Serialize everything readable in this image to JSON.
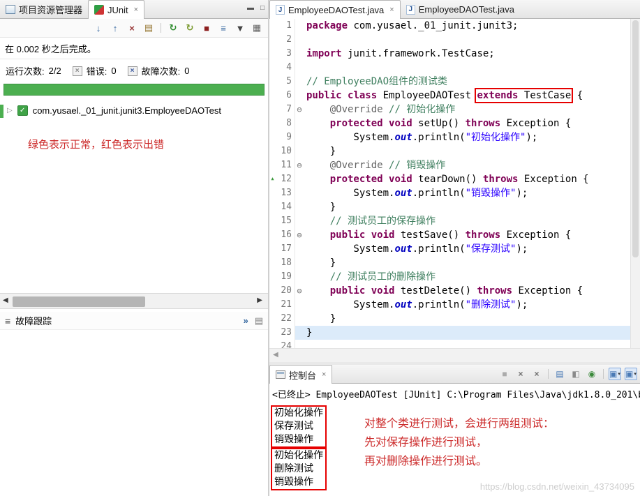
{
  "colors": {
    "kw": "#7f0055",
    "cm": "#3f7f5f",
    "st": "#2a00ff",
    "fd": "#0000c0",
    "an": "#646464",
    "ln": "#787878",
    "green": "#4caf50",
    "red": "#cc2a2a",
    "box_red": "#e60000",
    "cur": "#dcebfa"
  },
  "left_panel": {
    "tabs": [
      {
        "label": "项目资源管理器"
      },
      {
        "label": "JUnit",
        "close": "×"
      }
    ],
    "window_buttons": {
      "minimize": "▬",
      "maximize": "□"
    },
    "toolbar": [
      {
        "name": "next-failure-icon",
        "glyph": "↓",
        "color": "#35679f"
      },
      {
        "name": "previous-failure-icon",
        "glyph": "↑",
        "color": "#35679f"
      },
      {
        "name": "remove-test-run-icon",
        "glyph": "×",
        "color": "#9a3b3b"
      },
      {
        "name": "test-run-history-icon",
        "glyph": "▤",
        "color": "#9a7b3a"
      },
      {
        "name": "separator"
      },
      {
        "name": "rerun-test-icon",
        "glyph": "↻",
        "color": "#2e8b2e"
      },
      {
        "name": "rerun-failed-first-icon",
        "glyph": "↻",
        "color": "#7a9a2e"
      },
      {
        "name": "stop-test-icon",
        "glyph": "■",
        "color": "#8d2020"
      },
      {
        "name": "show-test-hierarchy-icon",
        "glyph": "≡",
        "color": "#35679f"
      },
      {
        "name": "dropdown-arrow-icon",
        "glyph": "▼",
        "color": "#444444"
      },
      {
        "name": "view-menu-icon",
        "glyph": "▦",
        "color": "#666666"
      }
    ],
    "status_text": "在 0.002 秒之后完成。",
    "stats": [
      {
        "label": "运行次数:",
        "value": "2/2"
      },
      {
        "label": "错误:",
        "value": "0"
      },
      {
        "label": "故障次数:",
        "value": "0"
      }
    ],
    "tree_item": {
      "expander": "▷",
      "label": "com.yusael._01_junit.junit3.EmployeeDAOTest"
    },
    "annotation": "绿色表示正常，红色表示出错",
    "failure_trace": {
      "label": "故障跟踪"
    }
  },
  "editor": {
    "tabs": [
      {
        "label": "EmployeeDAOTest.java",
        "close": "×"
      },
      {
        "label": "EmployeeDAOTest.java"
      }
    ],
    "current_line": 23,
    "fold_glyph": "⊖",
    "marker_glyph": "▲",
    "code_lines": [
      {
        "n": 1,
        "t": [
          [
            "kw",
            "package"
          ],
          [
            "pl",
            " com.yusael._01_junit.junit3;"
          ]
        ]
      },
      {
        "n": 2,
        "t": []
      },
      {
        "n": 3,
        "t": [
          [
            "kw",
            "import"
          ],
          [
            "pl",
            " junit.framework.TestCase;"
          ]
        ]
      },
      {
        "n": 4,
        "t": []
      },
      {
        "n": 5,
        "t": [
          [
            "cm",
            "// EmployeeDAO组件的测试类"
          ]
        ]
      },
      {
        "n": 6,
        "t": [
          [
            "kw",
            "public"
          ],
          [
            "pl",
            " "
          ],
          [
            "kw",
            "class"
          ],
          [
            "pl",
            " EmployeeDAOTest "
          ],
          [
            "kw",
            "extends",
            1
          ],
          [
            "pl",
            " TestCase",
            1
          ],
          [
            "pl",
            " {"
          ]
        ]
      },
      {
        "n": 7,
        "fold": true,
        "t": [
          [
            "pl",
            "    "
          ],
          [
            "an",
            "@Override"
          ],
          [
            "pl",
            " "
          ],
          [
            "cm",
            "// 初始化操作"
          ]
        ]
      },
      {
        "n": 8,
        "t": [
          [
            "pl",
            "    "
          ],
          [
            "kw",
            "protected"
          ],
          [
            "pl",
            " "
          ],
          [
            "kw",
            "void"
          ],
          [
            "pl",
            " setUp() "
          ],
          [
            "kw",
            "throws"
          ],
          [
            "pl",
            " Exception {"
          ]
        ]
      },
      {
        "n": 9,
        "t": [
          [
            "pl",
            "        System."
          ],
          [
            "fd",
            "out"
          ],
          [
            "pl",
            ".println("
          ],
          [
            "st",
            "\"初始化操作\""
          ],
          [
            "pl",
            ");"
          ]
        ]
      },
      {
        "n": 10,
        "t": [
          [
            "pl",
            "    }"
          ]
        ]
      },
      {
        "n": 11,
        "fold": true,
        "t": [
          [
            "pl",
            "    "
          ],
          [
            "an",
            "@Override"
          ],
          [
            "pl",
            " "
          ],
          [
            "cm",
            "// 销毁操作"
          ]
        ]
      },
      {
        "n": 12,
        "marker": true,
        "t": [
          [
            "pl",
            "    "
          ],
          [
            "kw",
            "protected"
          ],
          [
            "pl",
            " "
          ],
          [
            "kw",
            "void"
          ],
          [
            "pl",
            " tearDown() "
          ],
          [
            "kw",
            "throws"
          ],
          [
            "pl",
            " Exception {"
          ]
        ]
      },
      {
        "n": 13,
        "t": [
          [
            "pl",
            "        System."
          ],
          [
            "fd",
            "out"
          ],
          [
            "pl",
            ".println("
          ],
          [
            "st",
            "\"销毁操作\""
          ],
          [
            "pl",
            ");"
          ]
        ]
      },
      {
        "n": 14,
        "t": [
          [
            "pl",
            "    }"
          ]
        ]
      },
      {
        "n": 15,
        "t": [
          [
            "pl",
            "    "
          ],
          [
            "cm",
            "// 测试员工的保存操作"
          ]
        ]
      },
      {
        "n": 16,
        "fold": true,
        "t": [
          [
            "pl",
            "    "
          ],
          [
            "kw",
            "public"
          ],
          [
            "pl",
            " "
          ],
          [
            "kw",
            "void"
          ],
          [
            "pl",
            " testSave() "
          ],
          [
            "kw",
            "throws"
          ],
          [
            "pl",
            " Exception {"
          ]
        ]
      },
      {
        "n": 17,
        "t": [
          [
            "pl",
            "        System."
          ],
          [
            "fd",
            "out"
          ],
          [
            "pl",
            ".println("
          ],
          [
            "st",
            "\"保存测试\""
          ],
          [
            "pl",
            ");"
          ]
        ]
      },
      {
        "n": 18,
        "t": [
          [
            "pl",
            "    }"
          ]
        ]
      },
      {
        "n": 19,
        "t": [
          [
            "pl",
            "    "
          ],
          [
            "cm",
            "// 测试员工的删除操作"
          ]
        ]
      },
      {
        "n": 20,
        "fold": true,
        "t": [
          [
            "pl",
            "    "
          ],
          [
            "kw",
            "public"
          ],
          [
            "pl",
            " "
          ],
          [
            "kw",
            "void"
          ],
          [
            "pl",
            " testDelete() "
          ],
          [
            "kw",
            "throws"
          ],
          [
            "pl",
            " Exception {"
          ]
        ]
      },
      {
        "n": 21,
        "t": [
          [
            "pl",
            "        System."
          ],
          [
            "fd",
            "out"
          ],
          [
            "pl",
            ".println("
          ],
          [
            "st",
            "\"删除测试\""
          ],
          [
            "pl",
            ");"
          ]
        ]
      },
      {
        "n": 22,
        "t": [
          [
            "pl",
            "    }"
          ]
        ]
      },
      {
        "n": 23,
        "t": [
          [
            "pl",
            "}"
          ]
        ]
      },
      {
        "n": 24,
        "t": []
      }
    ]
  },
  "console": {
    "tab": {
      "label": "控制台",
      "close": "×"
    },
    "toolbar": [
      {
        "name": "terminate-icon",
        "glyph": "■",
        "color": "#ababab"
      },
      {
        "name": "remove-launch-icon",
        "glyph": "×",
        "color": "#6f6f6f"
      },
      {
        "name": "remove-all-launches-icon",
        "glyph": "×",
        "color": "#6f6f6f"
      },
      {
        "name": "separator"
      },
      {
        "name": "clear-console-icon",
        "glyph": "▤",
        "color": "#4a7ab5"
      },
      {
        "name": "scroll-lock-icon",
        "glyph": "◧",
        "color": "#8a8a8a"
      },
      {
        "name": "pin-console-icon",
        "glyph": "◉",
        "color": "#3c8a3c"
      },
      {
        "name": "separator"
      },
      {
        "name": "display-console-icon",
        "glyph": "▣",
        "color": "#4a7ab5",
        "dropdown": true,
        "selected": true
      },
      {
        "name": "open-console-icon",
        "glyph": "▣",
        "color": "#4a7ab5",
        "dropdown": true,
        "selected": true
      }
    ],
    "status_line": "<已终止> EmployeeDAOTest [JUnit] C:\\Program Files\\Java\\jdk1.8.0_201\\b",
    "output_groups": [
      {
        "lines": [
          "初始化操作",
          "保存测试",
          "销毁操作"
        ]
      },
      {
        "lines": [
          "初始化操作",
          "删除测试",
          "销毁操作"
        ]
      }
    ],
    "annotation_lines": [
      "对整个类进行测试，会进行两组测试：",
      "先对保存操作进行测试，",
      "再对删除操作进行测试。"
    ],
    "watermark": "https://blog.csdn.net/weixin_43734095"
  }
}
